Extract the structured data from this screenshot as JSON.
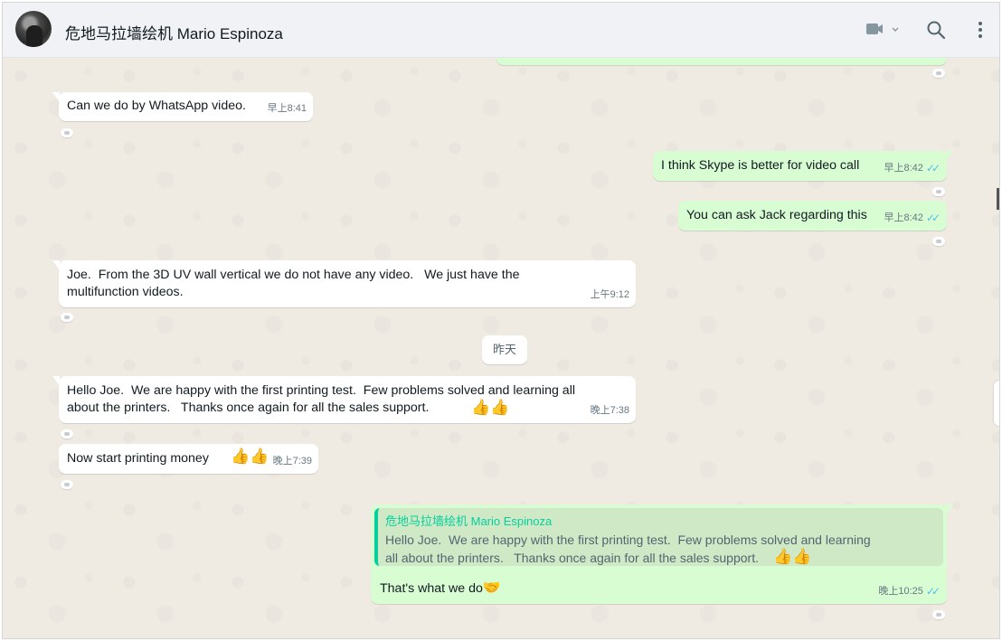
{
  "header": {
    "contact_name": "危地马拉墙绘机 Mario Espinoza",
    "video_caret": "⌄"
  },
  "day_divider": "昨天",
  "messages": [
    {
      "text": "Can we do by WhatsApp video.",
      "time": "早上8:41"
    },
    {
      "text": "I think Skype is better for video call",
      "time": "早上8:42"
    },
    {
      "text": "You can ask Jack regarding this",
      "time": "早上8:42"
    },
    {
      "text": "Joe.  From the 3D UV wall vertical we do not have any video.   We just have the\nmultifunction videos.",
      "time": "上午9:12"
    },
    {
      "text": "Hello Joe.  We are happy with the first printing test.  Few problems solved and learning all\nabout the printers.   Thanks once again for all the sales support.",
      "emoji": "👍👍",
      "time": "晚上7:38"
    },
    {
      "text": "Now start printing money",
      "emoji": "👍👍",
      "time": "晚上7:39"
    },
    {
      "quote_author": "危地马拉墙绘机 Mario Espinoza",
      "quote_text": "Hello Joe.  We are happy with the first printing test.  Few problems solved and learning\nall about the printers.   Thanks once again for all the sales support.",
      "quote_emoji": "👍👍",
      "text": "That's what we do",
      "emoji": "🤝",
      "time": "晚上10:25"
    }
  ],
  "ticks": "✓✓",
  "colors": {
    "incoming": "#ffffff",
    "outgoing": "#d9fdd3",
    "header_bg": "#f0f2f5",
    "chat_bg": "#efeae2",
    "read_ticks": "#53bdeb",
    "quote_accent": "#06cf9c"
  },
  "icons": [
    "video-call-icon",
    "search-icon",
    "menu-icon"
  ]
}
